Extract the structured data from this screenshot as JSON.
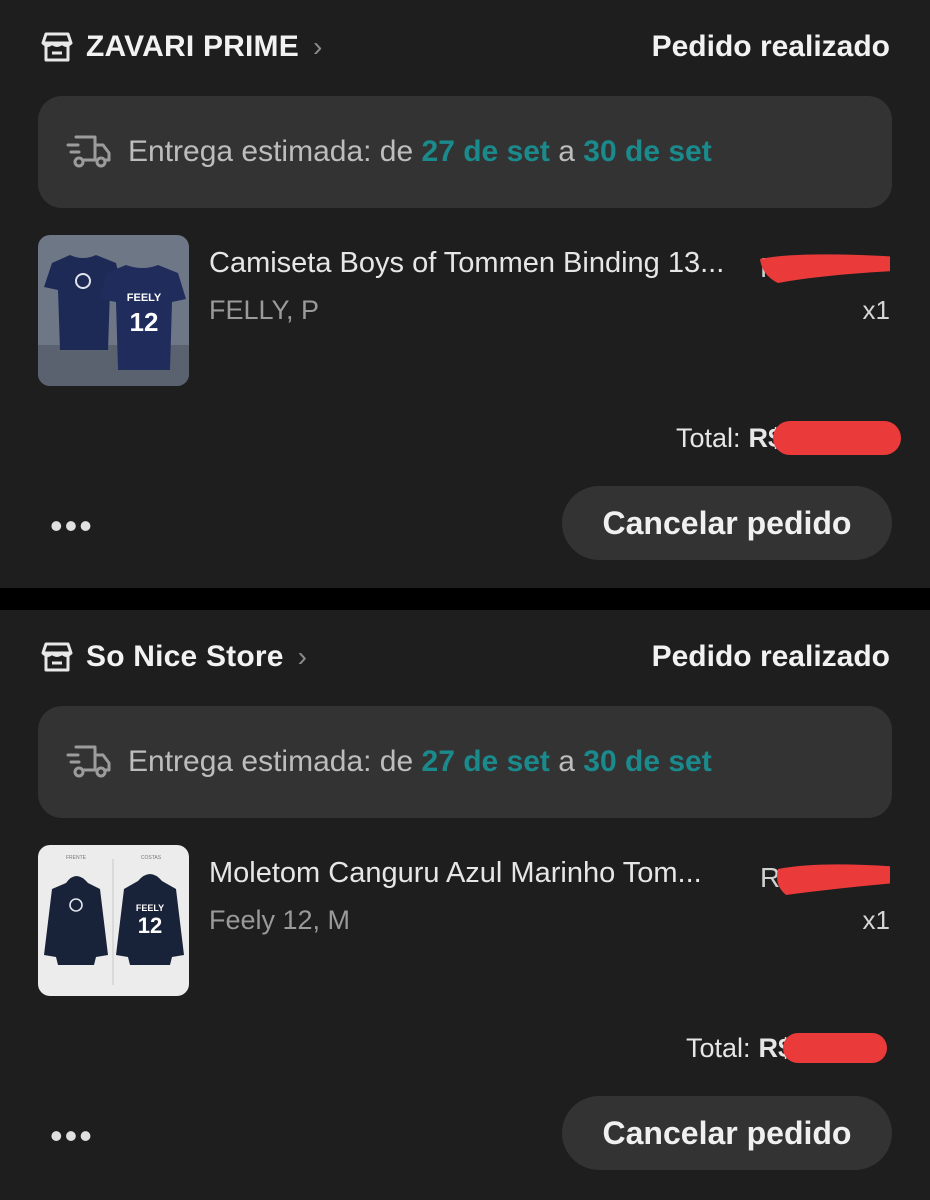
{
  "colors": {
    "background": "#1e1e1e",
    "card": "#333333",
    "accent_teal": "#1b8a8d",
    "redaction": "#ea3a3a"
  },
  "orders": [
    {
      "store_name": "ZAVARI PRIME",
      "store_icon": "store-icon",
      "status": "Pedido realizado",
      "delivery": {
        "prefix": "Entrega estimada: de ",
        "from": "27 de set",
        "mid": " a ",
        "to": "30 de set",
        "icon": "truck-icon"
      },
      "item": {
        "title": "Camiseta Boys of Tommen Binding 13...",
        "variant": "FELLY, P",
        "price_prefix": "R$",
        "quantity": "x1",
        "thumb": {
          "name_print": "FEELY",
          "number_print": "12"
        }
      },
      "total_label": "Total:",
      "total_currency": "R$",
      "more_label": "•••",
      "cancel_label": "Cancelar pedido"
    },
    {
      "store_name": "So Nice Store",
      "store_icon": "store-icon",
      "status": "Pedido realizado",
      "delivery": {
        "prefix": "Entrega estimada: de ",
        "from": "27 de set",
        "mid": " a ",
        "to": "30 de set",
        "icon": "truck-icon"
      },
      "item": {
        "title": "Moletom Canguru Azul Marinho Tom...",
        "variant": "Feely 12, M",
        "price_prefix": "R",
        "quantity": "x1",
        "thumb": {
          "left_caption": "FRENTE",
          "right_caption": "COSTAS",
          "name_print": "FEELY",
          "number_print": "12"
        }
      },
      "total_label": "Total:",
      "total_currency": "R$",
      "more_label": "•••",
      "cancel_label": "Cancelar pedido"
    }
  ]
}
